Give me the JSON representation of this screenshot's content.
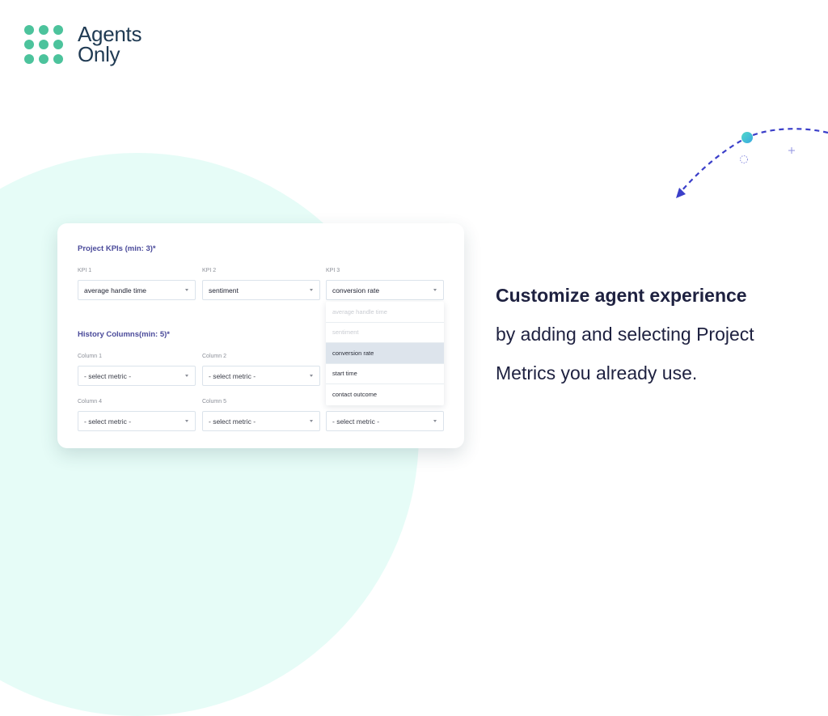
{
  "brand": {
    "name_line1": "Agents",
    "name_line2": "Only",
    "dot_color": "#4cc39c",
    "text_color": "#1f3a53"
  },
  "card": {
    "kpi_section": {
      "title": "Project KPIs (min: 3)*",
      "fields": [
        {
          "label": "KPI 1",
          "value": "average handle time"
        },
        {
          "label": "KPI 2",
          "value": "sentiment"
        },
        {
          "label": "KPI 3",
          "value": "conversion rate"
        }
      ],
      "open_dropdown": {
        "field": "KPI 3",
        "options": [
          {
            "label": "average handle time",
            "state": "disabled"
          },
          {
            "label": "sentiment",
            "state": "disabled"
          },
          {
            "label": "conversion rate",
            "state": "selected"
          },
          {
            "label": "start time",
            "state": "enabled"
          },
          {
            "label": "contact outcome",
            "state": "enabled"
          }
        ]
      }
    },
    "history_section": {
      "title": "History Columns(min: 5)*",
      "fields": [
        {
          "label": "Column 1",
          "value": "- select metric -"
        },
        {
          "label": "Column 2",
          "value": "- select metric -"
        },
        {
          "label": "Column 4",
          "value": "- select metric -"
        },
        {
          "label": "Column 5",
          "value": "- select metric -"
        },
        {
          "label": "",
          "value": "- select metric -"
        }
      ]
    }
  },
  "tagline": {
    "headline": "Customize agent experience",
    "line1": "by adding and selecting Project",
    "line2": "Metrics you already use."
  },
  "colors": {
    "accent_blue": "#3b3fc9",
    "mint_background": "#e6fcf7",
    "section_title": "#4a4a9a"
  }
}
